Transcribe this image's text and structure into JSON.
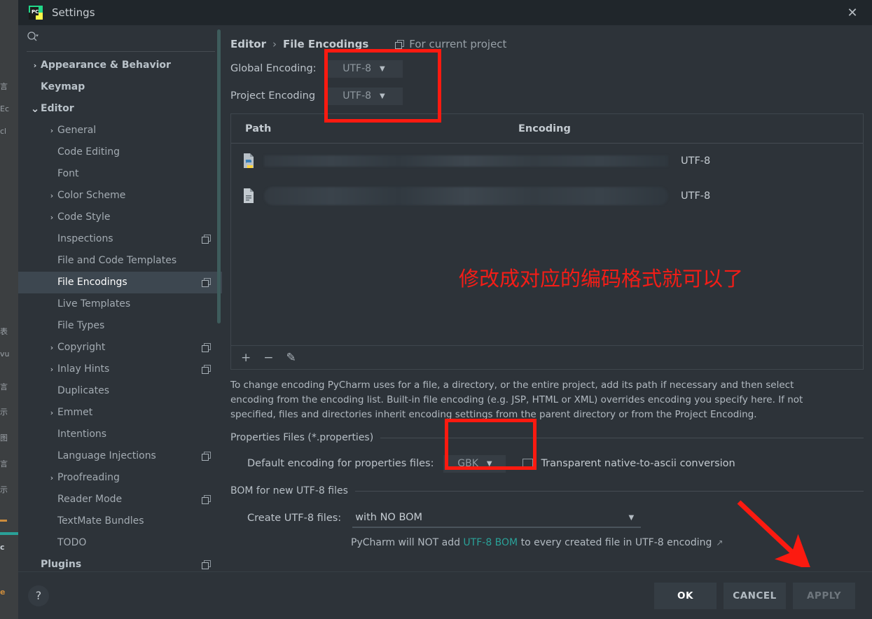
{
  "window": {
    "title": "Settings",
    "logo_icon": "pycharm-logo-icon",
    "close_icon": "✕"
  },
  "sidebar": {
    "search": {
      "placeholder": "",
      "value": "",
      "icon": "search-icon"
    },
    "items": [
      {
        "label": "Appearance & Behavior",
        "indent": 0,
        "arrow": "›",
        "bold": true,
        "selected": false,
        "copy": false
      },
      {
        "label": "Keymap",
        "indent": 0,
        "arrow": "",
        "bold": true,
        "selected": false,
        "copy": false
      },
      {
        "label": "Editor",
        "indent": 0,
        "arrow": "⌄",
        "bold": true,
        "selected": false,
        "copy": false
      },
      {
        "label": "General",
        "indent": 1,
        "arrow": "›",
        "bold": false,
        "selected": false,
        "copy": false
      },
      {
        "label": "Code Editing",
        "indent": 1,
        "arrow": "",
        "bold": false,
        "selected": false,
        "copy": false
      },
      {
        "label": "Font",
        "indent": 1,
        "arrow": "",
        "bold": false,
        "selected": false,
        "copy": false
      },
      {
        "label": "Color Scheme",
        "indent": 1,
        "arrow": "›",
        "bold": false,
        "selected": false,
        "copy": false
      },
      {
        "label": "Code Style",
        "indent": 1,
        "arrow": "›",
        "bold": false,
        "selected": false,
        "copy": false
      },
      {
        "label": "Inspections",
        "indent": 1,
        "arrow": "",
        "bold": false,
        "selected": false,
        "copy": true
      },
      {
        "label": "File and Code Templates",
        "indent": 1,
        "arrow": "",
        "bold": false,
        "selected": false,
        "copy": false
      },
      {
        "label": "File Encodings",
        "indent": 1,
        "arrow": "",
        "bold": false,
        "selected": true,
        "copy": true
      },
      {
        "label": "Live Templates",
        "indent": 1,
        "arrow": "",
        "bold": false,
        "selected": false,
        "copy": false
      },
      {
        "label": "File Types",
        "indent": 1,
        "arrow": "",
        "bold": false,
        "selected": false,
        "copy": false
      },
      {
        "label": "Copyright",
        "indent": 1,
        "arrow": "›",
        "bold": false,
        "selected": false,
        "copy": true
      },
      {
        "label": "Inlay Hints",
        "indent": 1,
        "arrow": "›",
        "bold": false,
        "selected": false,
        "copy": true
      },
      {
        "label": "Duplicates",
        "indent": 1,
        "arrow": "",
        "bold": false,
        "selected": false,
        "copy": false
      },
      {
        "label": "Emmet",
        "indent": 1,
        "arrow": "›",
        "bold": false,
        "selected": false,
        "copy": false
      },
      {
        "label": "Intentions",
        "indent": 1,
        "arrow": "",
        "bold": false,
        "selected": false,
        "copy": false
      },
      {
        "label": "Language Injections",
        "indent": 1,
        "arrow": "",
        "bold": false,
        "selected": false,
        "copy": true
      },
      {
        "label": "Proofreading",
        "indent": 1,
        "arrow": "›",
        "bold": false,
        "selected": false,
        "copy": false
      },
      {
        "label": "Reader Mode",
        "indent": 1,
        "arrow": "",
        "bold": false,
        "selected": false,
        "copy": true
      },
      {
        "label": "TextMate Bundles",
        "indent": 1,
        "arrow": "",
        "bold": false,
        "selected": false,
        "copy": false
      },
      {
        "label": "TODO",
        "indent": 1,
        "arrow": "",
        "bold": false,
        "selected": false,
        "copy": false
      },
      {
        "label": "Plugins",
        "indent": 0,
        "arrow": "",
        "bold": true,
        "selected": false,
        "copy": true
      }
    ]
  },
  "main": {
    "breadcrumb": {
      "parent": "Editor",
      "separator": "›",
      "current": "File Encodings"
    },
    "scope_label": "For current project",
    "global_encoding": {
      "label": "Global Encoding:",
      "value": "UTF-8"
    },
    "project_encoding": {
      "label": "Project Encoding",
      "value": "UTF-8"
    },
    "table": {
      "columns": [
        "Path",
        "Encoding"
      ],
      "rows": [
        {
          "icon": "python-file-icon",
          "path": "",
          "encoding": "UTF-8"
        },
        {
          "icon": "text-file-icon",
          "path": "",
          "encoding": "UTF-8"
        }
      ]
    },
    "toolbar": {
      "add": "+",
      "remove": "−",
      "edit": "✎"
    },
    "description": "To change encoding PyCharm uses for a file, a directory, or the entire project, add its path if necessary and then select encoding from the encoding list. Built-in file encoding (e.g. JSP, HTML or XML) overrides encoding you specify here. If not specified, files and directories inherit encoding settings from the parent directory or from the Project Encoding.",
    "properties_section": {
      "title": "Properties Files (*.properties)",
      "default_encoding_label": "Default encoding for properties files:",
      "default_encoding_value": "GBK",
      "checkbox_label": "Transparent native-to-ascii conversion",
      "checkbox_checked": false
    },
    "bom_section": {
      "title": "BOM for new UTF-8 files",
      "create_label": "Create UTF-8 files:",
      "create_value": "with NO BOM",
      "note_prefix": "PyCharm will NOT add ",
      "note_link": "UTF-8 BOM",
      "note_suffix": " to every created file in UTF-8 encoding",
      "external_link_icon": "↗"
    }
  },
  "annotations": {
    "chinese_note": "修改成对应的编码格式就可以了",
    "highlight_color": "#fc1a10"
  },
  "footer": {
    "help_label": "?",
    "ok_label": "OK",
    "cancel_label": "CANCEL",
    "apply_label": "APPLY"
  },
  "background_strip": {
    "fragments": [
      "言",
      "Ec",
      "cl",
      "表",
      "vu",
      "言",
      "示",
      "图",
      "言",
      "示",
      "c",
      "e"
    ]
  }
}
